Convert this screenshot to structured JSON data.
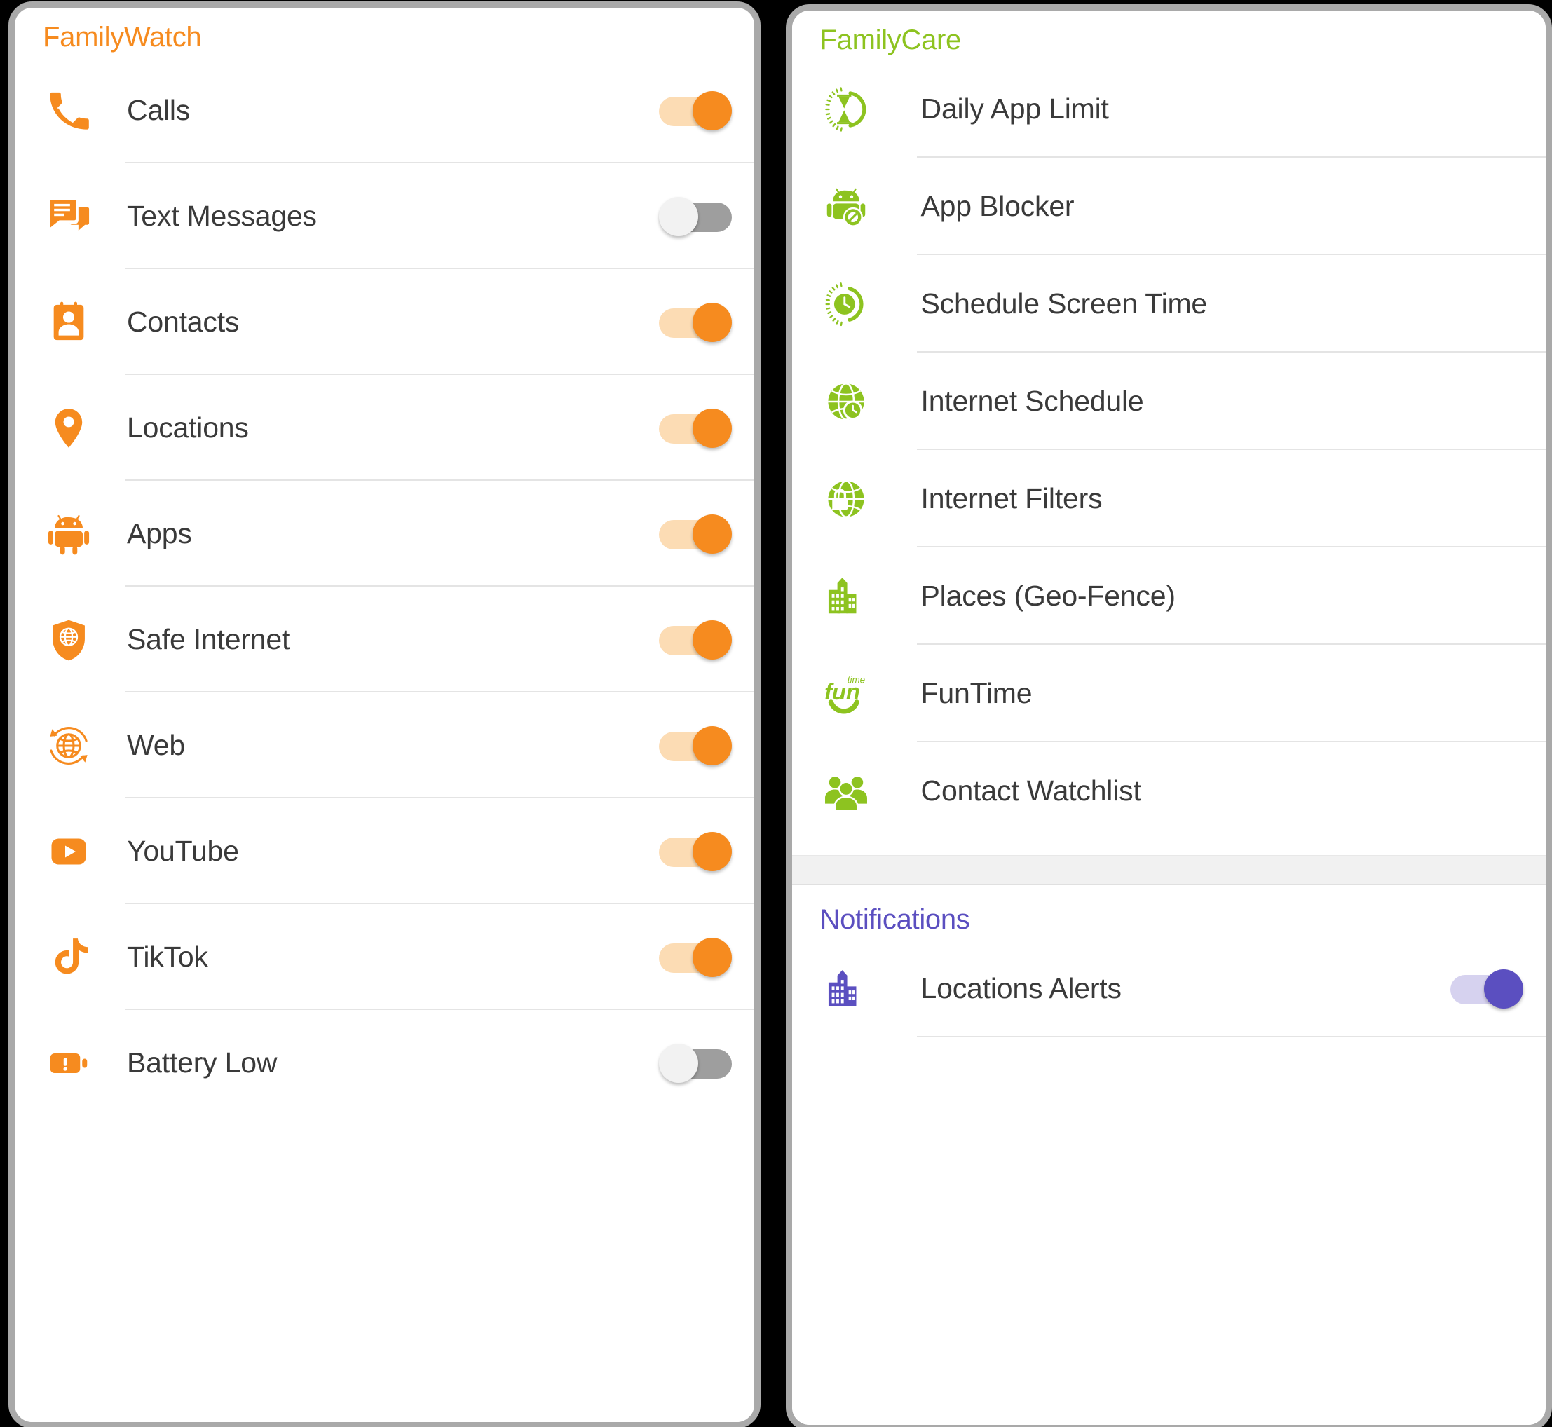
{
  "colors": {
    "orange": "#f68b1f",
    "green": "#8dc320",
    "purple": "#5b4fc0",
    "toggle_off_track": "#9e9e9e",
    "toggle_off_thumb": "#f2f2f2",
    "label_text": "#3a3a3a",
    "divider": "#e4e4e4",
    "band": "#f1f1f1",
    "page_background": "#000000",
    "panel_border": "#a9a9a9"
  },
  "left_panel": {
    "header": "FamilyWatch",
    "items": [
      {
        "label": "Calls",
        "icon": "phone-icon",
        "toggle": "on",
        "toggle_color": "orange"
      },
      {
        "label": "Text Messages",
        "icon": "chat-bubble-icon",
        "toggle": "off",
        "toggle_color": "grey"
      },
      {
        "label": "Contacts",
        "icon": "contacts-book-icon",
        "toggle": "on",
        "toggle_color": "orange"
      },
      {
        "label": "Locations",
        "icon": "map-pin-icon",
        "toggle": "on",
        "toggle_color": "orange"
      },
      {
        "label": "Apps",
        "icon": "android-robot-icon",
        "toggle": "on",
        "toggle_color": "orange"
      },
      {
        "label": "Safe Internet",
        "icon": "shield-globe-icon",
        "toggle": "on",
        "toggle_color": "orange"
      },
      {
        "label": "Web",
        "icon": "globe-refresh-icon",
        "toggle": "on",
        "toggle_color": "orange"
      },
      {
        "label": "YouTube",
        "icon": "youtube-icon",
        "toggle": "on",
        "toggle_color": "orange"
      },
      {
        "label": "TikTok",
        "icon": "tiktok-note-icon",
        "toggle": "on",
        "toggle_color": "orange"
      },
      {
        "label": "Battery Low",
        "icon": "battery-alert-icon",
        "toggle": "off",
        "toggle_color": "grey"
      }
    ]
  },
  "right_panel": {
    "header": "FamilyCare",
    "items": [
      {
        "label": "Daily App Limit",
        "icon": "hourglass-icon"
      },
      {
        "label": "App Blocker",
        "icon": "android-block-icon"
      },
      {
        "label": "Schedule Screen Time",
        "icon": "clock-rays-icon"
      },
      {
        "label": "Internet Schedule",
        "icon": "globe-clock-icon"
      },
      {
        "label": "Internet Filters",
        "icon": "globe-lock-icon"
      },
      {
        "label": "Places (Geo-Fence)",
        "icon": "buildings-icon"
      },
      {
        "label": "FunTime",
        "icon": "funtime-smile-icon"
      },
      {
        "label": "Contact Watchlist",
        "icon": "people-group-icon"
      }
    ],
    "notifications": {
      "header": "Notifications",
      "items": [
        {
          "label": "Locations Alerts",
          "icon": "buildings-icon",
          "toggle": "on",
          "toggle_color": "purple"
        }
      ]
    }
  }
}
